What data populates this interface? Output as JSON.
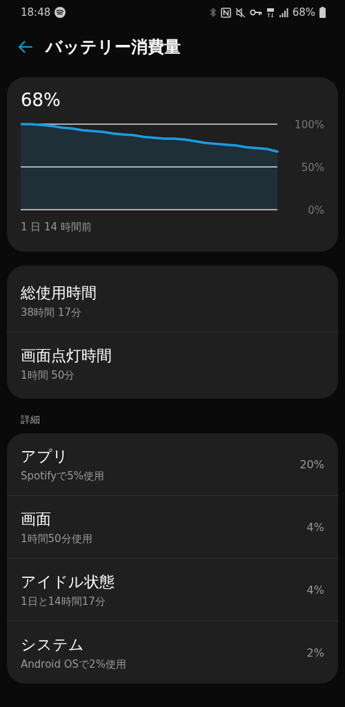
{
  "status_bar": {
    "time": "18:48",
    "battery_text": "68%"
  },
  "header": {
    "title": "バッテリー消費量"
  },
  "battery_card": {
    "percent": "68%",
    "time_label": "1 日 14 時間前",
    "chart_data": {
      "type": "area",
      "categories": [
        null,
        null,
        null,
        null,
        null,
        null,
        null,
        null,
        null,
        null,
        null,
        null,
        null,
        null,
        null,
        null,
        null,
        null,
        null,
        null,
        null,
        null,
        null,
        null,
        null,
        null
      ],
      "ylim": [
        0,
        100
      ],
      "yticks": [
        {
          "value": 0,
          "label": "0%"
        },
        {
          "value": 50,
          "label": "50%"
        },
        {
          "value": 100,
          "label": "100%"
        }
      ],
      "series": [
        {
          "color": "#1a9be0",
          "values": [
            100,
            100,
            99,
            98,
            96,
            95,
            93,
            92,
            91,
            89,
            88,
            87,
            85,
            84,
            83,
            83,
            82,
            80,
            78,
            77,
            76,
            75,
            73,
            72,
            71,
            68
          ]
        }
      ]
    }
  },
  "totals": [
    {
      "title": "総使用時間",
      "value": "38時間 17分"
    },
    {
      "title": "画面点灯時間",
      "value": "1時間 50分"
    }
  ],
  "details": {
    "heading": "詳細",
    "items": [
      {
        "title": "アプリ",
        "subtitle": "Spotifyで5%使用",
        "percent": "20%"
      },
      {
        "title": "画面",
        "subtitle": "1時間50分使用",
        "percent": "4%"
      },
      {
        "title": "アイドル状態",
        "subtitle": "1日と14時間17分",
        "percent": "4%"
      },
      {
        "title": "システム",
        "subtitle": "Android OSで2%使用",
        "percent": "2%"
      }
    ]
  }
}
